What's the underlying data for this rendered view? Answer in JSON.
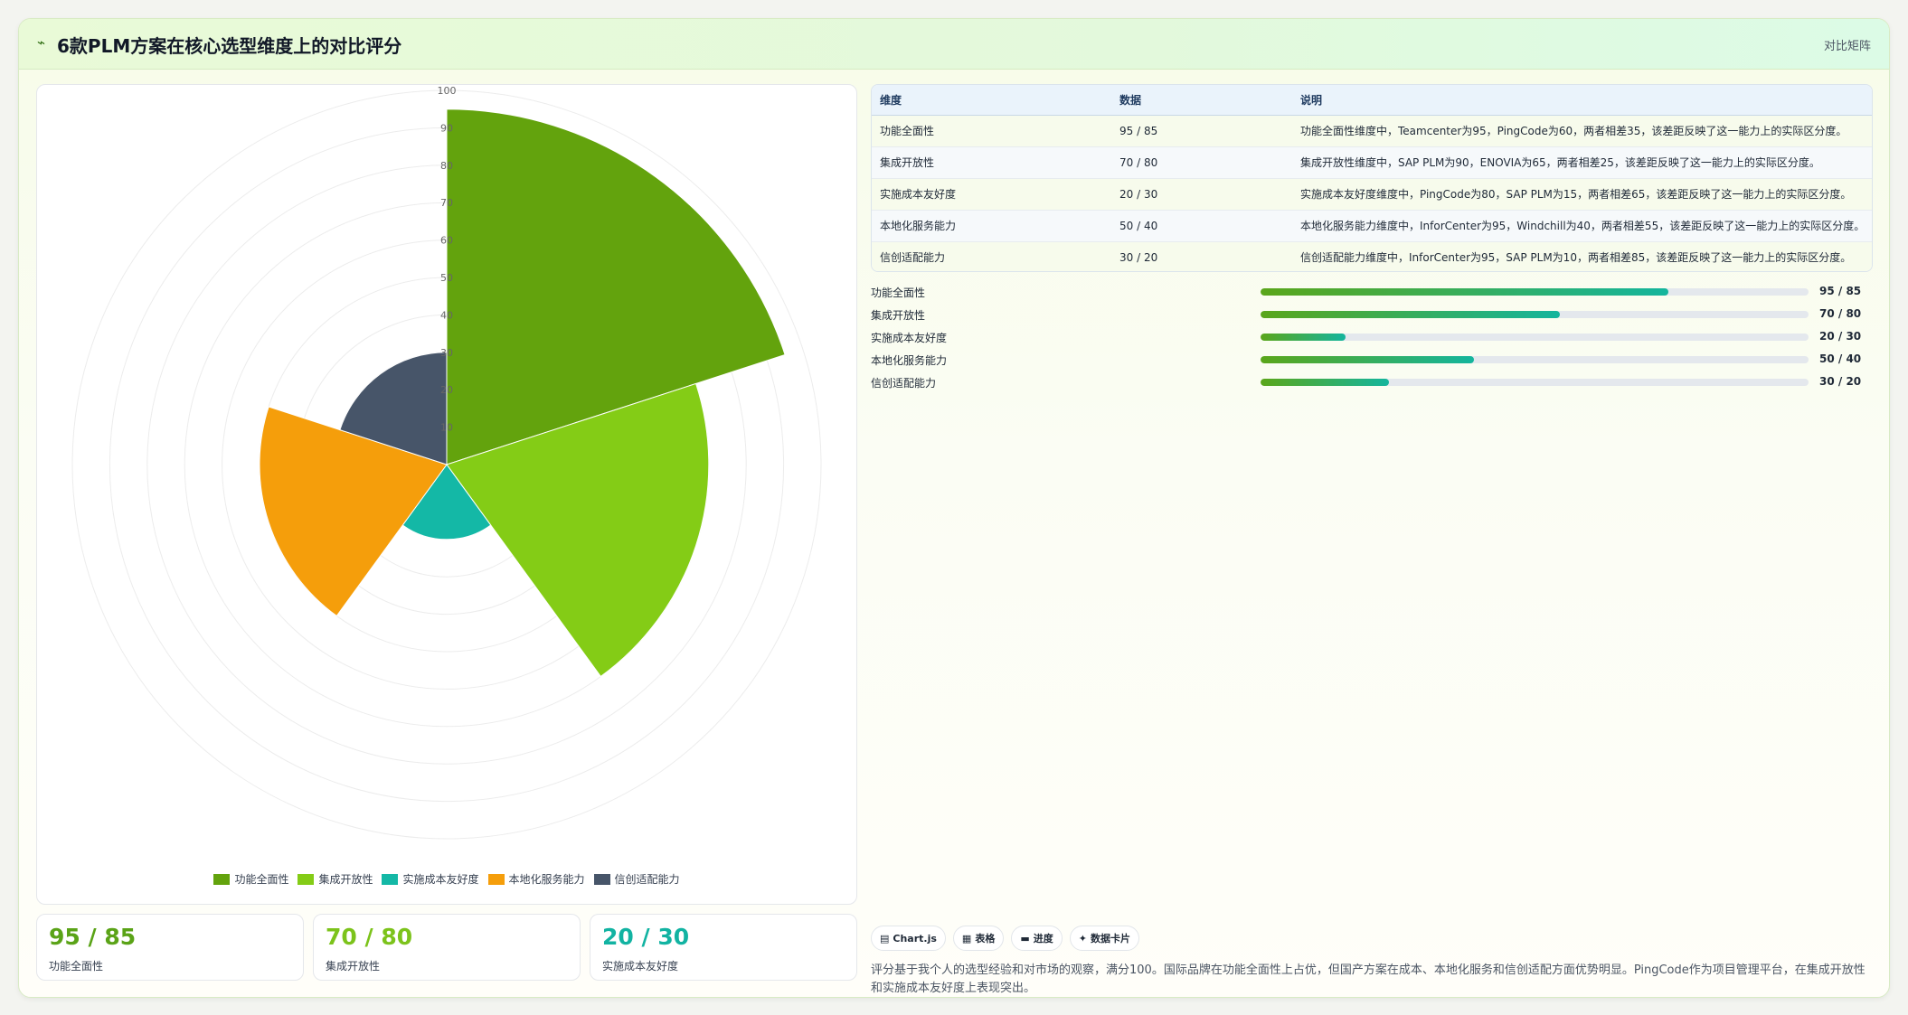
{
  "header": {
    "icon": "chart-line-icon",
    "title": "6款PLM方案在核心选型维度上的对比评分",
    "badge": "对比矩阵"
  },
  "chart_data": {
    "type": "polarArea",
    "categories": [
      "功能全面性",
      "集成开放性",
      "实施成本友好度",
      "本地化服务能力",
      "信创适配能力"
    ],
    "values": [
      95,
      70,
      20,
      50,
      30
    ],
    "colors": [
      "#63a30d",
      "#84cc16",
      "#14b8a6",
      "#f59e0b",
      "#475569"
    ],
    "r_range": [
      0,
      100
    ],
    "ticks": [
      10,
      20,
      30,
      40,
      50,
      60,
      70,
      80,
      90,
      100
    ],
    "legend_position": "bottom",
    "grid": true
  },
  "stats": [
    {
      "value": "95 / 85",
      "label": "功能全面性",
      "color": "#5aa317"
    },
    {
      "value": "70 / 80",
      "label": "集成开放性",
      "color": "#7cc31b"
    },
    {
      "value": "20 / 30",
      "label": "实施成本友好度",
      "color": "#12b3a2"
    }
  ],
  "table": {
    "headers": [
      "维度",
      "数据",
      "说明"
    ],
    "rows": [
      [
        "功能全面性",
        "95 / 85",
        "功能全面性维度中，Teamcenter为95，PingCode为60，两者相差35，该差距反映了这一能力上的实际区分度。"
      ],
      [
        "集成开放性",
        "70 / 80",
        "集成开放性维度中，SAP PLM为90，ENOVIA为65，两者相差25，该差距反映了这一能力上的实际区分度。"
      ],
      [
        "实施成本友好度",
        "20 / 30",
        "实施成本友好度维度中，PingCode为80，SAP PLM为15，两者相差65，该差距反映了这一能力上的实际区分度。"
      ],
      [
        "本地化服务能力",
        "50 / 40",
        "本地化服务能力维度中，InforCenter为95，Windchill为40，两者相差55，该差距反映了这一能力上的实际区分度。"
      ],
      [
        "信创适配能力",
        "30 / 20",
        "信创适配能力维度中，InforCenter为95，SAP PLM为10，两者相差85，该差距反映了这一能力上的实际区分度。"
      ]
    ]
  },
  "progress": [
    {
      "label": "功能全面性",
      "value": "95 / 85",
      "fill_percent": 74.5
    },
    {
      "label": "集成开放性",
      "value": "70 / 80",
      "fill_percent": 54.7
    },
    {
      "label": "实施成本友好度",
      "value": "20 / 30",
      "fill_percent": 15.5
    },
    {
      "label": "本地化服务能力",
      "value": "50 / 40",
      "fill_percent": 39.0
    },
    {
      "label": "信创适配能力",
      "value": "30 / 20",
      "fill_percent": 23.4
    }
  ],
  "chips": [
    {
      "icon": "chart-icon",
      "glyph": "▤",
      "label": "Chart.js"
    },
    {
      "icon": "table-icon",
      "glyph": "▦",
      "label": "表格"
    },
    {
      "icon": "progress-icon",
      "glyph": "▬",
      "label": "进度"
    },
    {
      "icon": "sparkle-icon",
      "glyph": "✦",
      "label": "数据卡片"
    }
  ],
  "footnote": "评分基于我个人的选型经验和对市场的观察，满分100。国际品牌在功能全面性上占优，但国产方案在成本、本地化服务和信创适配方面优势明显。PingCode作为项目管理平台，在集成开放性和实施成本友好度上表现突出。"
}
